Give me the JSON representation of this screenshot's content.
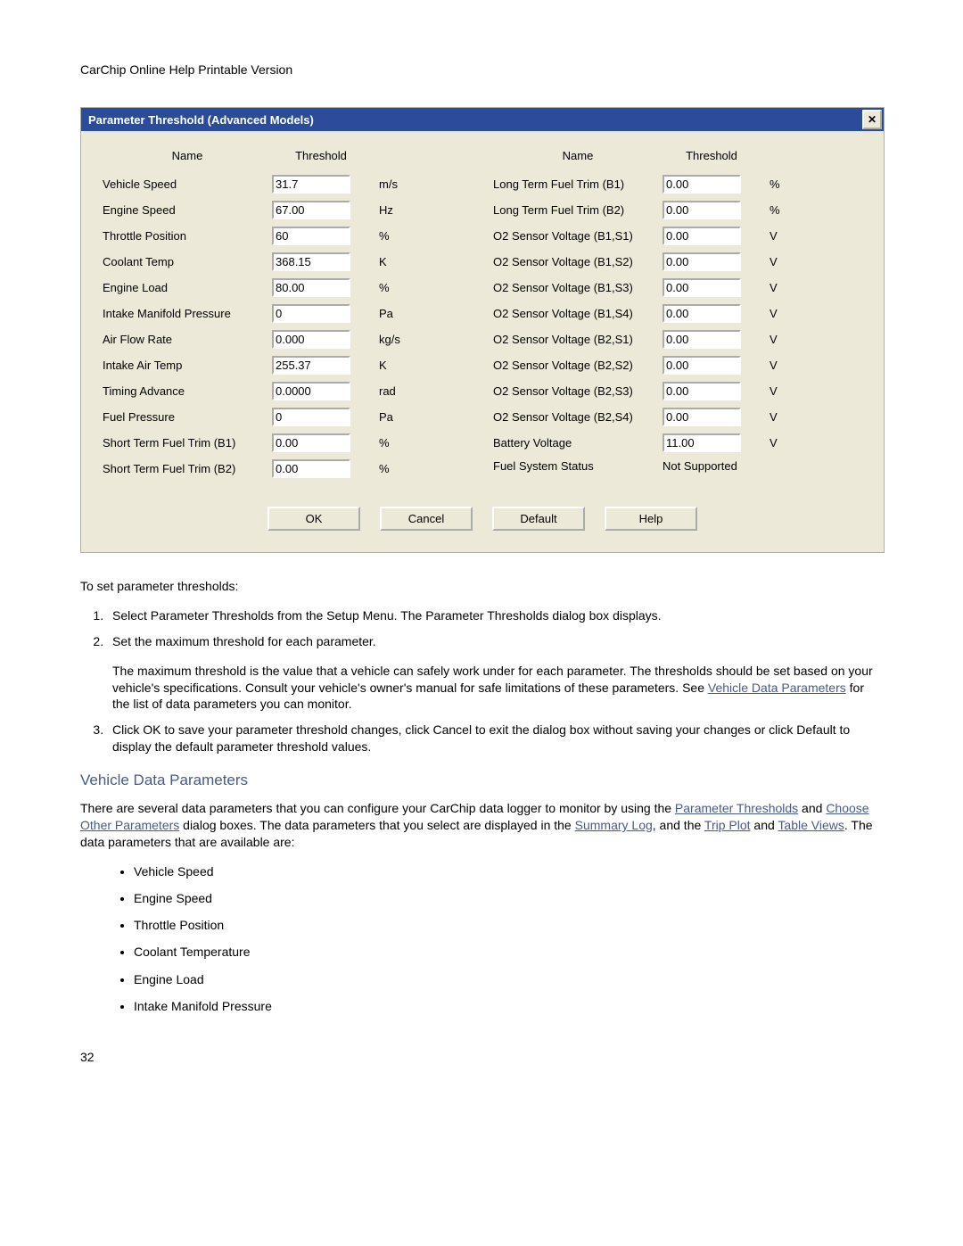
{
  "page_header": "CarChip Online Help Printable Version",
  "dialog": {
    "title": "Parameter Threshold  (Advanced Models)",
    "headers": {
      "name": "Name",
      "threshold": "Threshold"
    },
    "close_icon": "✕",
    "left": [
      {
        "name": "Vehicle Speed",
        "value": "31.7",
        "unit": "m/s"
      },
      {
        "name": "Engine Speed",
        "value": "67.00",
        "unit": "Hz"
      },
      {
        "name": "Throttle Position",
        "value": "60",
        "unit": "%"
      },
      {
        "name": "Coolant Temp",
        "value": "368.15",
        "unit": "K"
      },
      {
        "name": "Engine Load",
        "value": "80.00",
        "unit": "%"
      },
      {
        "name": "Intake Manifold Pressure",
        "value": "0",
        "unit": "Pa"
      },
      {
        "name": "Air Flow Rate",
        "value": "0.000",
        "unit": "kg/s"
      },
      {
        "name": "Intake Air Temp",
        "value": "255.37",
        "unit": "K"
      },
      {
        "name": "Timing Advance",
        "value": "0.0000",
        "unit": "rad"
      },
      {
        "name": "Fuel Pressure",
        "value": "0",
        "unit": "Pa"
      },
      {
        "name": "Short Term Fuel Trim (B1)",
        "value": "0.00",
        "unit": "%"
      },
      {
        "name": "Short Term Fuel Trim (B2)",
        "value": "0.00",
        "unit": "%"
      }
    ],
    "right": [
      {
        "name": "Long Term Fuel Trim (B1)",
        "value": "0.00",
        "unit": "%"
      },
      {
        "name": "Long Term Fuel Trim (B2)",
        "value": "0.00",
        "unit": "%"
      },
      {
        "name": "O2 Sensor Voltage (B1,S1)",
        "value": "0.00",
        "unit": "V"
      },
      {
        "name": "O2 Sensor Voltage (B1,S2)",
        "value": "0.00",
        "unit": "V"
      },
      {
        "name": "O2 Sensor Voltage (B1,S3)",
        "value": "0.00",
        "unit": "V"
      },
      {
        "name": "O2 Sensor Voltage (B1,S4)",
        "value": "0.00",
        "unit": "V"
      },
      {
        "name": "O2 Sensor Voltage (B2,S1)",
        "value": "0.00",
        "unit": "V"
      },
      {
        "name": "O2 Sensor Voltage (B2,S2)",
        "value": "0.00",
        "unit": "V"
      },
      {
        "name": "O2 Sensor Voltage (B2,S3)",
        "value": "0.00",
        "unit": "V"
      },
      {
        "name": "O2 Sensor Voltage (B2,S4)",
        "value": "0.00",
        "unit": "V"
      },
      {
        "name": "Battery Voltage",
        "value": "11.00",
        "unit": "V"
      },
      {
        "name": "Fuel System Status",
        "value": "Not Supported",
        "unit": "",
        "noinput": true
      }
    ],
    "buttons": {
      "ok": "OK",
      "cancel": "Cancel",
      "default": "Default",
      "help": "Help"
    }
  },
  "instructions": {
    "intro": "To set parameter thresholds:",
    "step1a": "Select Parameter Thresholds from the Setup   Menu. The Parameter Thresholds      dialog box displays.",
    "step2a": "Set the maximum threshold for each parameter.",
    "step2b": "The maximum threshold is the value that a vehicle can safely work under for each parameter. The thresholds should be set based on your vehicle's specifications. Consult your vehicle's owner's manual for safe limitations of these parameters. See ",
    "step2c": " for the list of data parameters you can monitor.",
    "step3": "Click OK  to save your parameter threshold changes, click Cancel   to exit the dialog box without saving your changes or click Default    to display the default parameter threshold values."
  },
  "links": {
    "vdp": "Vehicle Data Parameters",
    "pt": "Parameter Thresholds",
    "cop": "Choose Other Parameters",
    "sl": "Summary Log",
    "tp": "Trip Plot",
    "tv": "Table Views"
  },
  "section": {
    "title": "Vehicle Data Parameters",
    "para_a": "There are several data parameters that you can configure your CarChip data logger to monitor by using the ",
    "para_b": " and ",
    "para_c": " dialog boxes. The data parameters that you select are displayed in the ",
    "para_d": ", and the ",
    "para_e": " and ",
    "para_f": ". The data parameters that are available are:",
    "bullets": [
      "Vehicle Speed",
      "Engine Speed",
      "Throttle Position",
      "Coolant Temperature",
      "Engine Load",
      "Intake Manifold Pressure"
    ]
  },
  "page_number": "32"
}
